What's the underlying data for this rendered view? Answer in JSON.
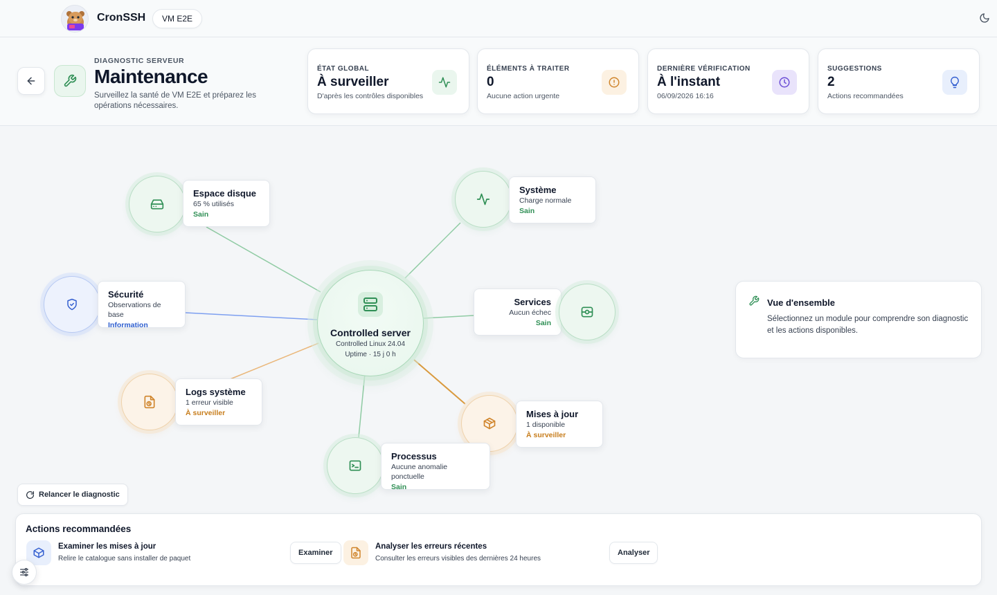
{
  "app": {
    "name": "CronSSH",
    "vm_chip": "VM E2E"
  },
  "header": {
    "eyebrow": "DIAGNOSTIC SERVEUR",
    "title": "Maintenance",
    "subtitle": "Surveillez la santé de VM E2E et préparez les opérations nécessaires."
  },
  "stats": [
    {
      "label": "ÉTAT GLOBAL",
      "value": "À surveiller",
      "sub": "D'après les contrôles disponibles",
      "icon": "activity-icon",
      "color": "#2f8f55"
    },
    {
      "label": "ÉLÉMENTS À TRAITER",
      "value": "0",
      "sub": "Aucune action urgente",
      "icon": "alert-circle-icon",
      "color": "#d0852c"
    },
    {
      "label": "DERNIÈRE VÉRIFICATION",
      "value": "À l'instant",
      "sub": "06/09/2026 16:16",
      "icon": "clock-icon",
      "color": "#6d4fd6"
    },
    {
      "label": "SUGGESTIONS",
      "value": "2",
      "sub": "Actions recommandées",
      "icon": "lightbulb-icon",
      "color": "#3560d0"
    }
  ],
  "hub": {
    "title": "Controlled server",
    "os": "Controlled Linux 24.04",
    "uptime": "Uptime · 15 j 0 h"
  },
  "modules": {
    "disk": {
      "title": "Espace disque",
      "sub": "65 % utilisés",
      "status": "Sain"
    },
    "system": {
      "title": "Système",
      "sub": "Charge normale",
      "status": "Sain"
    },
    "security": {
      "title": "Sécurité",
      "sub": "Observations de base",
      "status": "Information"
    },
    "services": {
      "title": "Services",
      "sub": "Aucun échec",
      "status": "Sain"
    },
    "logs": {
      "title": "Logs système",
      "sub": "1 erreur visible",
      "status": "À surveiller"
    },
    "updates": {
      "title": "Mises à jour",
      "sub": "1 disponible",
      "status": "À surveiller"
    },
    "processes": {
      "title": "Processus",
      "sub": "Aucune anomalie ponctuelle",
      "status": "Sain"
    }
  },
  "rerun_label": "Relancer le diagnostic",
  "overview": {
    "title": "Vue d'ensemble",
    "text": "Sélectionnez un module pour comprendre son diagnostic et les actions disponibles."
  },
  "actions": {
    "title": "Actions recommandées",
    "items": [
      {
        "title": "Examiner les mises à jour",
        "sub": "Relire le catalogue sans installer de paquet",
        "button": "Examiner"
      },
      {
        "title": "Analyser les erreurs récentes",
        "sub": "Consulter les erreurs visibles des dernières 24 heures",
        "button": "Analyser"
      }
    ]
  },
  "colors": {
    "healthy": "#2f8f55",
    "info": "#3560d0",
    "warning": "#d0852c"
  }
}
